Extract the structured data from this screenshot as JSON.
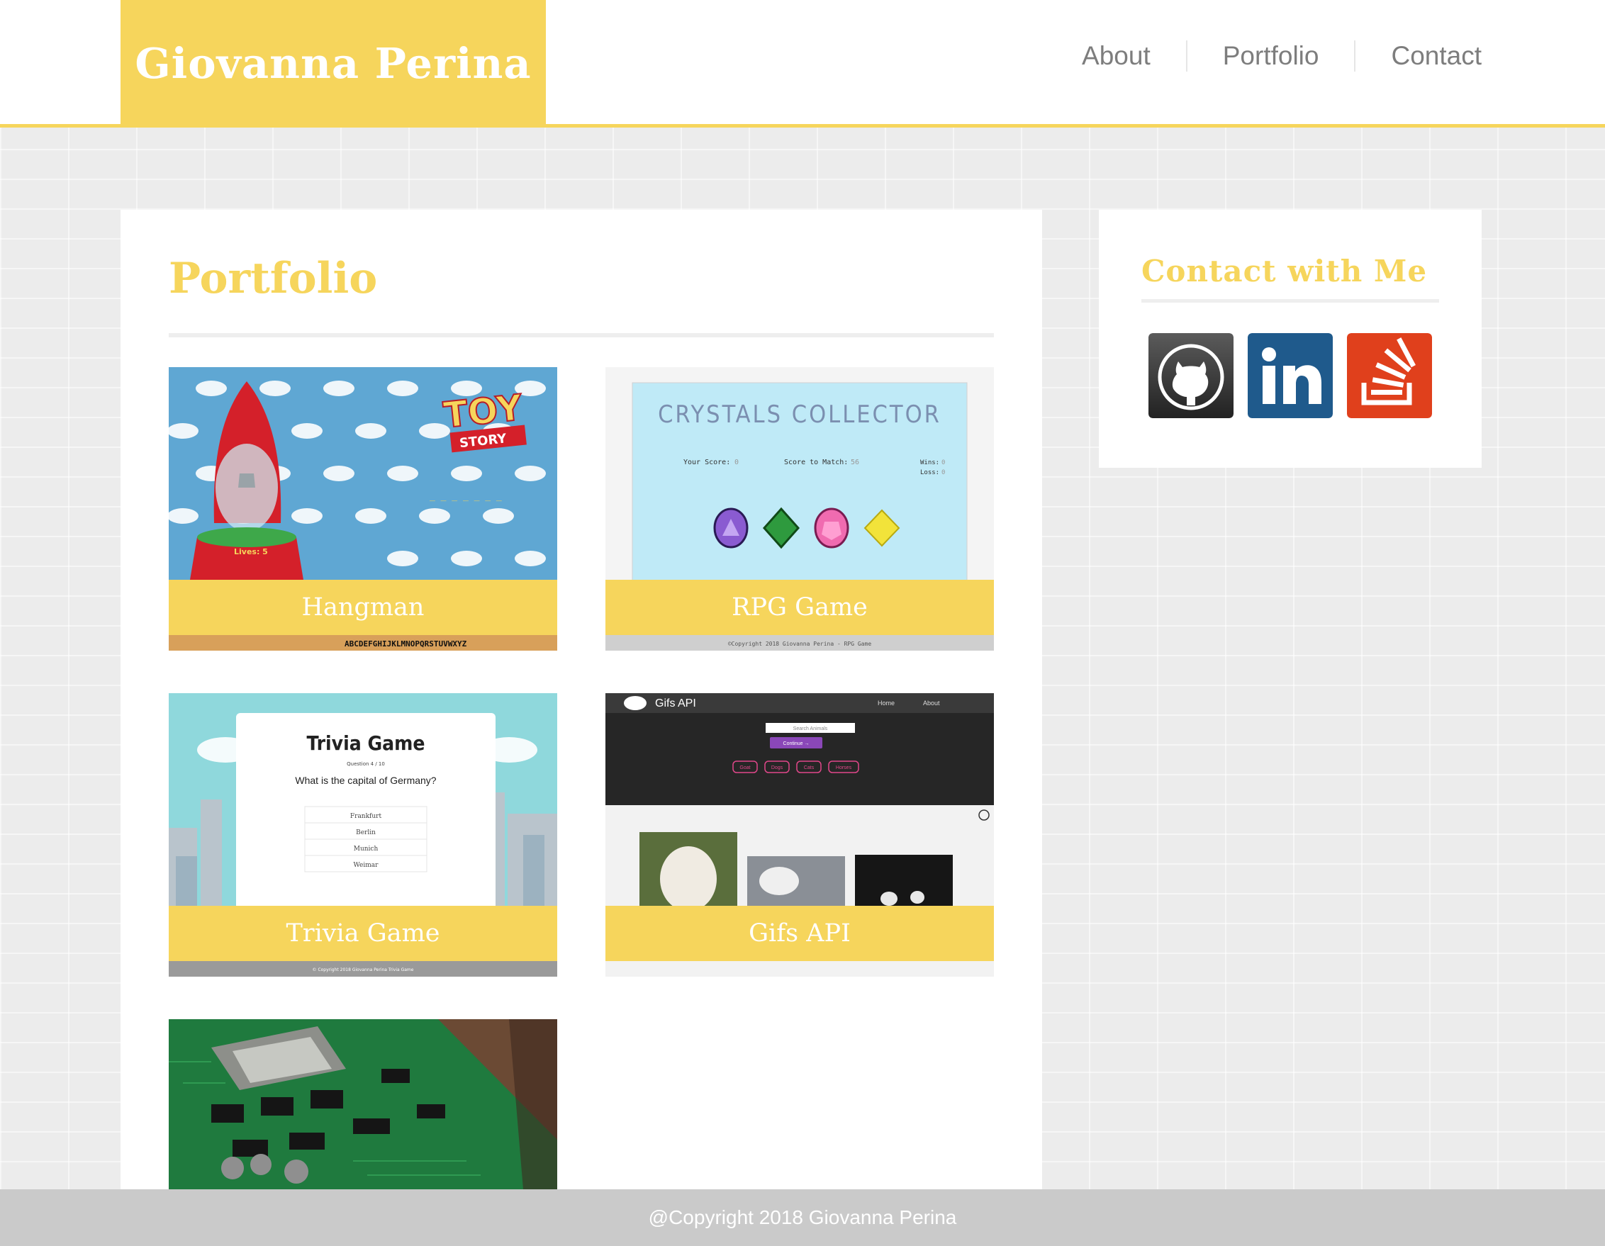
{
  "header": {
    "brand": "Giovanna Perina",
    "nav": [
      "About",
      "Portfolio",
      "Contact"
    ]
  },
  "main": {
    "title": "Portfolio",
    "projects": [
      {
        "caption": "Hangman",
        "thumb": {
          "logo_top": "TOY",
          "logo_bottom": "STORY",
          "lives": "Lives: 5",
          "letters": "ABCDEFGHIJKLMNOPQRSTUVWXYZ",
          "blanks": "_ _ _ _ _ _ _"
        }
      },
      {
        "caption": "RPG Game",
        "thumb": {
          "heading": "CRYSTALS COLLECTOR",
          "score_label": "Your Score:",
          "score_value": "0",
          "match_label": "Score to Match:",
          "match_value": "56",
          "wins_label": "Wins:",
          "wins_value": "0",
          "loss_label": "Loss:",
          "loss_value": "0",
          "copyright": "©Copyright 2018 Giovanna Perina - RPG Game"
        }
      },
      {
        "caption": "Trivia Game",
        "thumb": {
          "heading": "Trivia Game",
          "question_count": "Question 4 / 10",
          "question": "What is the capital of Germany?",
          "options": [
            "Frankfurt",
            "Berlin",
            "Munich",
            "Weimar"
          ],
          "copyright": "© Copyright 2018 Giovanna Perina  Trivia Game"
        }
      },
      {
        "caption": "Gifs API",
        "thumb": {
          "app_title": "Gifs API",
          "nav": [
            "Home",
            "About"
          ],
          "search_placeholder": "Search Animals",
          "continue_label": "Continue →",
          "tags": [
            "Goat",
            "Dogs",
            "Cats",
            "Horses"
          ]
        }
      },
      {
        "caption": ""
      }
    ]
  },
  "sidebar": {
    "title": "Contact with Me",
    "social": [
      {
        "name": "github",
        "icon": "github-icon",
        "color": "#333333"
      },
      {
        "name": "linkedin",
        "icon": "linkedin-icon",
        "color": "#1f5a8c"
      },
      {
        "name": "stackoverflow",
        "icon": "stackoverflow-icon",
        "color": "#e0401c"
      }
    ]
  },
  "footer": {
    "text": "@Copyright 2018 Giovanna Perina"
  },
  "colors": {
    "accent": "#f6d55c",
    "nav_text": "#7d7d7d",
    "footer_bg": "#cacaca"
  }
}
